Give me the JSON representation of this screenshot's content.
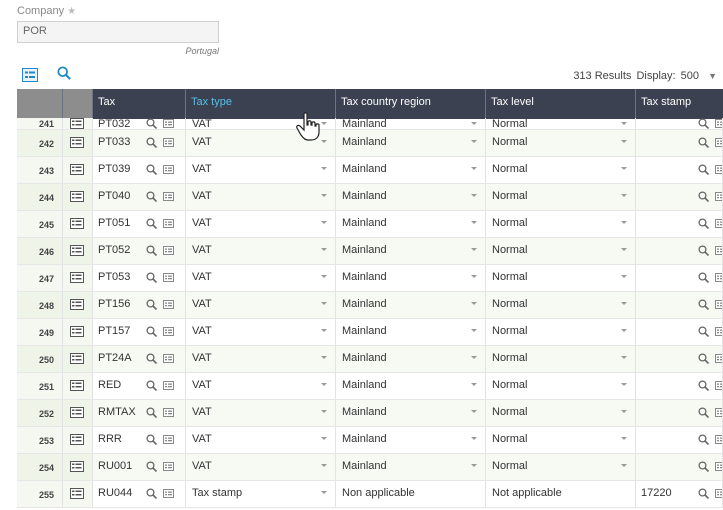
{
  "company": {
    "label": "Company",
    "value": "POR",
    "description": "Portugal"
  },
  "toolbar": {
    "results": "313 Results",
    "display_label": "Display:",
    "display_value": "500"
  },
  "columns": [
    "Tax",
    "Tax type",
    "Tax country region",
    "Tax level",
    "Tax stamp"
  ],
  "rows": [
    {
      "num": "241",
      "tax": "PT032",
      "type": "VAT",
      "region": "Mainland",
      "level": "Normal",
      "stamp": ""
    },
    {
      "num": "242",
      "tax": "PT033",
      "type": "VAT",
      "region": "Mainland",
      "level": "Normal",
      "stamp": ""
    },
    {
      "num": "243",
      "tax": "PT039",
      "type": "VAT",
      "region": "Mainland",
      "level": "Normal",
      "stamp": ""
    },
    {
      "num": "244",
      "tax": "PT040",
      "type": "VAT",
      "region": "Mainland",
      "level": "Normal",
      "stamp": ""
    },
    {
      "num": "245",
      "tax": "PT051",
      "type": "VAT",
      "region": "Mainland",
      "level": "Normal",
      "stamp": ""
    },
    {
      "num": "246",
      "tax": "PT052",
      "type": "VAT",
      "region": "Mainland",
      "level": "Normal",
      "stamp": ""
    },
    {
      "num": "247",
      "tax": "PT053",
      "type": "VAT",
      "region": "Mainland",
      "level": "Normal",
      "stamp": ""
    },
    {
      "num": "248",
      "tax": "PT156",
      "type": "VAT",
      "region": "Mainland",
      "level": "Normal",
      "stamp": ""
    },
    {
      "num": "249",
      "tax": "PT157",
      "type": "VAT",
      "region": "Mainland",
      "level": "Normal",
      "stamp": ""
    },
    {
      "num": "250",
      "tax": "PT24A",
      "type": "VAT",
      "region": "Mainland",
      "level": "Normal",
      "stamp": ""
    },
    {
      "num": "251",
      "tax": "RED",
      "type": "VAT",
      "region": "Mainland",
      "level": "Normal",
      "stamp": ""
    },
    {
      "num": "252",
      "tax": "RMTAX",
      "type": "VAT",
      "region": "Mainland",
      "level": "Normal",
      "stamp": ""
    },
    {
      "num": "253",
      "tax": "RRR",
      "type": "VAT",
      "region": "Mainland",
      "level": "Normal",
      "stamp": ""
    },
    {
      "num": "254",
      "tax": "RU001",
      "type": "VAT",
      "region": "Mainland",
      "level": "Normal",
      "stamp": ""
    },
    {
      "num": "255",
      "tax": "RU044",
      "type": "Tax stamp",
      "region": "Non applicable",
      "level": "Not applicable",
      "stamp": "17220"
    }
  ],
  "colors": {
    "header_bg": "#3b4150",
    "header_active": "#55c0e8",
    "icon_blue": "#1e88c8"
  },
  "icons": [
    "list-view-icon",
    "search-icon",
    "row-detail-icon",
    "lookup-icon",
    "dropdown-arrow-icon",
    "hand-cursor-icon"
  ]
}
